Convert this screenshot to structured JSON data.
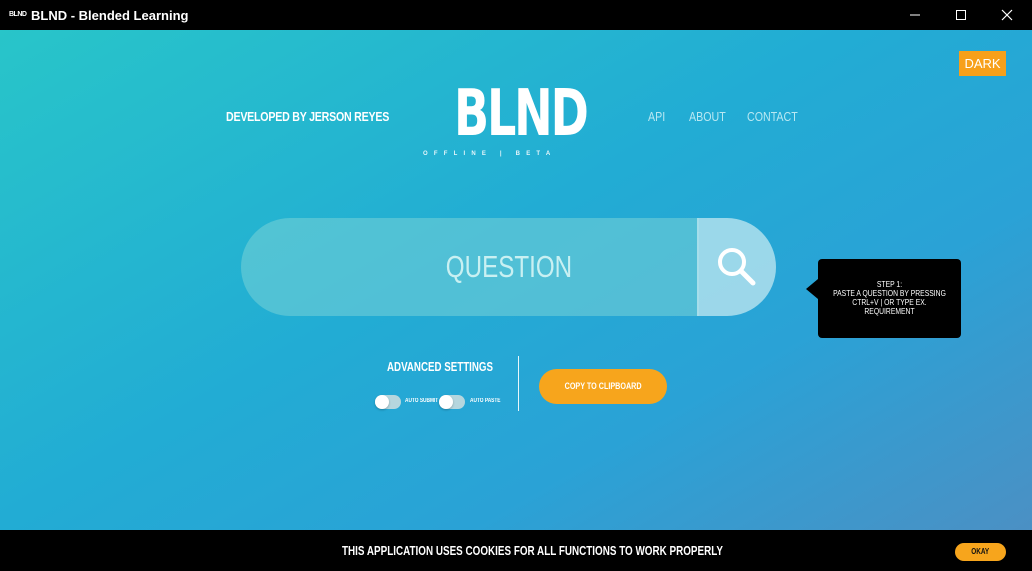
{
  "window": {
    "icon_text": "BLND",
    "title": "BLND - Blended Learning"
  },
  "header": {
    "dark_button": "DARK",
    "developer": "DEVELOPED BY JERSON REYES",
    "logo": "BLND",
    "logo_sub": "OFFLINE | BETA",
    "nav": [
      {
        "label": "API"
      },
      {
        "label": "ABOUT"
      },
      {
        "label": "CONTACT"
      }
    ]
  },
  "search": {
    "placeholder": "QUESTION",
    "button_icon": "search-icon"
  },
  "tooltip": {
    "line1": "STEP 1:",
    "line2": "PASTE A QUESTION BY PRESSING",
    "line3": "CTRL+V | OR TYPE EX.",
    "line4": "REQUIREMENT"
  },
  "settings": {
    "title": "ADVANCED SETTINGS",
    "auto_submit_label": "AUTO SUBMIT",
    "auto_submit_on": false,
    "auto_paste_label": "AUTO PASTE",
    "auto_paste_on": false,
    "copy_button": "COPY TO CLIPBOARD"
  },
  "cookie": {
    "message": "THIS APPLICATION USES COOKIES FOR ALL FUNCTIONS TO WORK PROPERLY",
    "okay": "OKAY"
  },
  "colors": {
    "accent": "#f7a51c",
    "gradient_start": "#28c5c9",
    "gradient_end": "#4b90c4"
  }
}
